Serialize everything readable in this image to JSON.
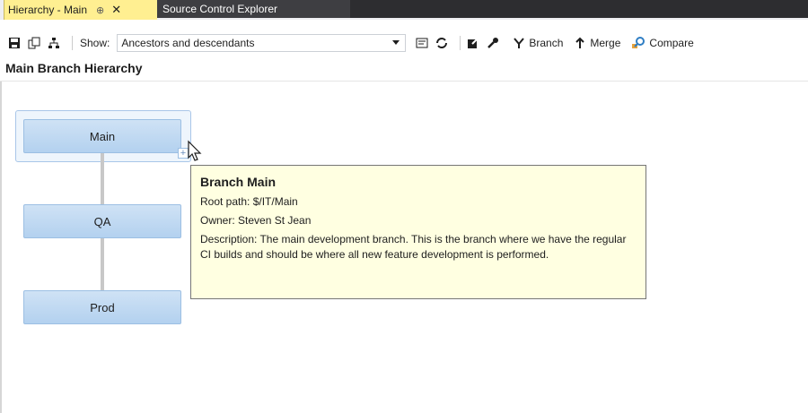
{
  "tabs": {
    "active": {
      "title": "Hierarchy - Main",
      "pin": "⊕",
      "close": "✕"
    },
    "inactive": {
      "title": "Source Control Explorer"
    }
  },
  "toolbar": {
    "icons": [
      "save-icon",
      "copy-icon",
      "hierarchy-icon"
    ],
    "show_label": "Show:",
    "show_value": "Ancestors and descendants",
    "branch_label": "Branch",
    "merge_label": "Merge",
    "compare_label": "Compare"
  },
  "page": {
    "title": "Main Branch Hierarchy"
  },
  "branches": [
    {
      "name": "Main"
    },
    {
      "name": "QA"
    },
    {
      "name": "Prod"
    }
  ],
  "tooltip": {
    "title": "Branch Main",
    "root_path": "Root path: $/IT/Main",
    "owner": "Owner: Steven St Jean",
    "description": "Description: The main development branch. This is the branch where we have the regular CI builds and should be where all new feature development is performed."
  },
  "colors": {
    "active_tab": "#ffef91",
    "tab_strip_dark": "#2d2d30",
    "node_fill": "#b3d1ef",
    "tooltip_bg": "#ffffe1"
  }
}
